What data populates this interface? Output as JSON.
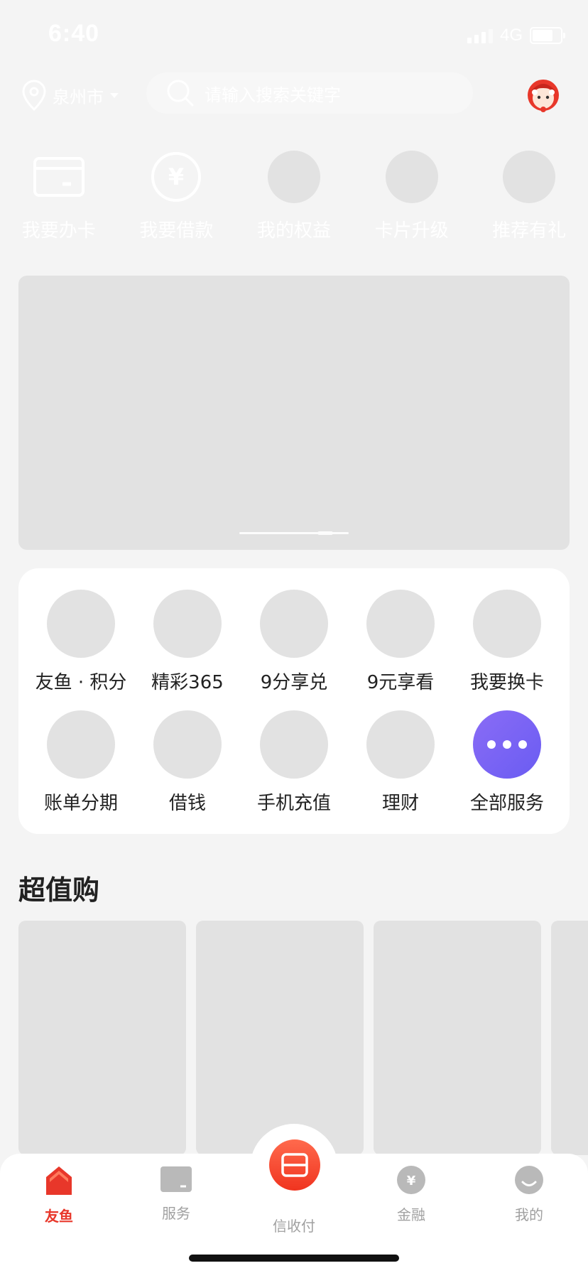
{
  "status_bar": {
    "time": "6:40",
    "network": "4G",
    "battery_level": 0.75
  },
  "header": {
    "city": "泉州市",
    "search_placeholder": "请输入搜索关键字"
  },
  "quick_entries": [
    {
      "label": "我要办卡",
      "icon": "card-icon"
    },
    {
      "label": "我要借款",
      "icon": "yen-coin-icon"
    },
    {
      "label": "我的权益",
      "icon": "placeholder-circle"
    },
    {
      "label": "卡片升级",
      "icon": "placeholder-circle"
    },
    {
      "label": "推荐有礼",
      "icon": "placeholder-circle"
    }
  ],
  "banner": {
    "page_count": 5,
    "active_index": 3
  },
  "services": [
    {
      "label": "友鱼 · 积分"
    },
    {
      "label": "精彩365"
    },
    {
      "label": "9分享兑"
    },
    {
      "label": "9元享看"
    },
    {
      "label": "我要换卡"
    },
    {
      "label": "账单分期"
    },
    {
      "label": "借钱"
    },
    {
      "label": "手机充值"
    },
    {
      "label": "理财"
    },
    {
      "label": "全部服务"
    }
  ],
  "section": {
    "title": "超值购"
  },
  "tabbar": {
    "items": [
      {
        "label": "友鱼",
        "icon": "home-icon",
        "active": true
      },
      {
        "label": "服务",
        "icon": "service-card-icon",
        "active": false
      },
      {
        "label": "信收付",
        "icon": "scan-icon",
        "active": false
      },
      {
        "label": "金融",
        "icon": "yen-icon",
        "active": false
      },
      {
        "label": "我的",
        "icon": "profile-icon",
        "active": false
      }
    ]
  },
  "colors": {
    "accent": "#e8372a",
    "purple": "#7361f4",
    "placeholder": "#e2e2e2"
  }
}
